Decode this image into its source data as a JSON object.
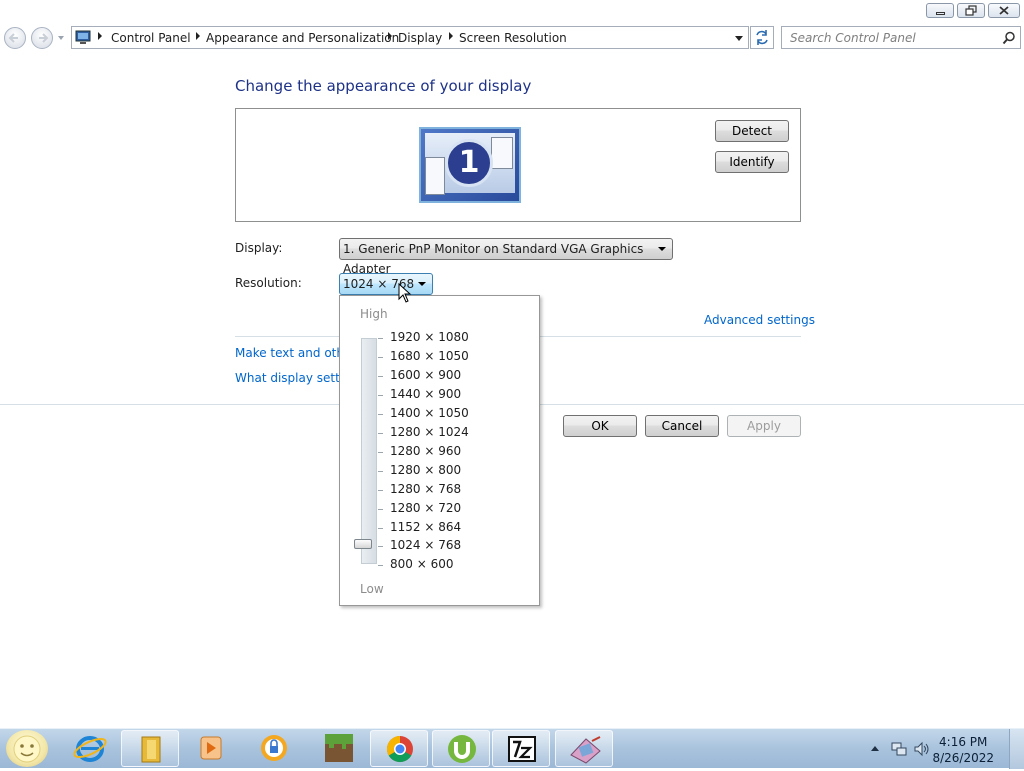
{
  "breadcrumb": [
    "Control Panel",
    "Appearance and Personalization",
    "Display",
    "Screen Resolution"
  ],
  "search": {
    "placeholder": "Search Control Panel"
  },
  "main": {
    "heading": "Change the appearance of your display",
    "monitor_number": "1",
    "detect_label": "Detect",
    "identify_label": "Identify",
    "display_label": "Display:",
    "display_value": "1. Generic PnP Monitor on Standard VGA Graphics Adapter",
    "resolution_label": "Resolution:",
    "resolution_value": "1024 × 768",
    "advanced_link": "Advanced settings",
    "link_text_size": "Make text and other",
    "link_display_settings": "What display setting",
    "ok_label": "OK",
    "cancel_label": "Cancel",
    "apply_label": "Apply"
  },
  "dropdown": {
    "high_label": "High",
    "low_label": "Low",
    "options": [
      "1920 × 1080",
      "1680 × 1050",
      "1600 × 900",
      "1440 × 900",
      "1400 × 1050",
      "1280 × 1024",
      "1280 × 960",
      "1280 × 800",
      "1280 × 768",
      "1280 × 720",
      "1152 × 864",
      "1024 × 768",
      "800 × 600"
    ],
    "selected": "1024 × 768"
  },
  "taskbar": {
    "icons": [
      "start-orb-icon",
      "internet-explorer-icon",
      "file-explorer-icon",
      "media-player-icon",
      "lock-app-icon",
      "minecraft-icon",
      "chrome-icon",
      "utorrent-icon",
      "7zip-icon",
      "paint-app-icon"
    ],
    "time": "4:16 PM",
    "date": "8/26/2022"
  }
}
